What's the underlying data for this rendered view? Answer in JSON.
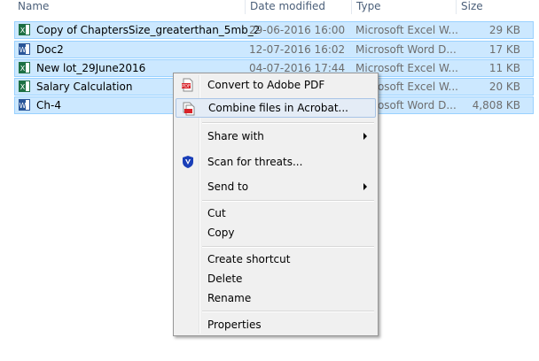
{
  "columns": {
    "name": "Name",
    "date": "Date modified",
    "type": "Type",
    "size": "Size"
  },
  "files": [
    {
      "name": "Copy of ChaptersSize_greaterthan_5mb_2",
      "date": "29-06-2016 16:00",
      "type": "Microsoft Excel W...",
      "size": "29 KB",
      "icon": "excel-file-icon"
    },
    {
      "name": "Doc2",
      "date": "12-07-2016 16:02",
      "type": "Microsoft Word D...",
      "size": "17 KB",
      "icon": "word-file-icon"
    },
    {
      "name": "New lot_29June2016",
      "date": "04-07-2016 17:44",
      "type": "Microsoft Excel W...",
      "size": "11 KB",
      "icon": "excel-file-icon"
    },
    {
      "name": "Salary Calculation",
      "date": "",
      "type": "Microsoft Excel W...",
      "size": "20 KB",
      "icon": "excel-file-icon"
    },
    {
      "name": "Ch-4",
      "date": "",
      "type": "Microsoft Word D...",
      "size": "4,808 KB",
      "icon": "word-file-icon"
    }
  ],
  "context_menu": {
    "items": [
      {
        "label": "Convert to Adobe PDF",
        "icon": "adobe-pdf-icon"
      },
      {
        "label": "Combine files in Acrobat...",
        "icon": "acrobat-combine-icon"
      },
      {
        "label": "Share with"
      },
      {
        "label": "Scan for threats...",
        "icon": "shield-scan-icon"
      },
      {
        "label": "Send to"
      },
      {
        "label": "Cut"
      },
      {
        "label": "Copy"
      },
      {
        "label": "Create shortcut"
      },
      {
        "label": "Delete"
      },
      {
        "label": "Rename"
      },
      {
        "label": "Properties"
      }
    ]
  },
  "colors": {
    "selection": "#cce8ff",
    "selection_border": "#99d1ff",
    "menu_bg": "#f0f0f0",
    "menu_highlight": "#e4ecf6",
    "excel_green": "#1d7044",
    "word_blue": "#2a5699",
    "pdf_red": "#d8232a"
  }
}
